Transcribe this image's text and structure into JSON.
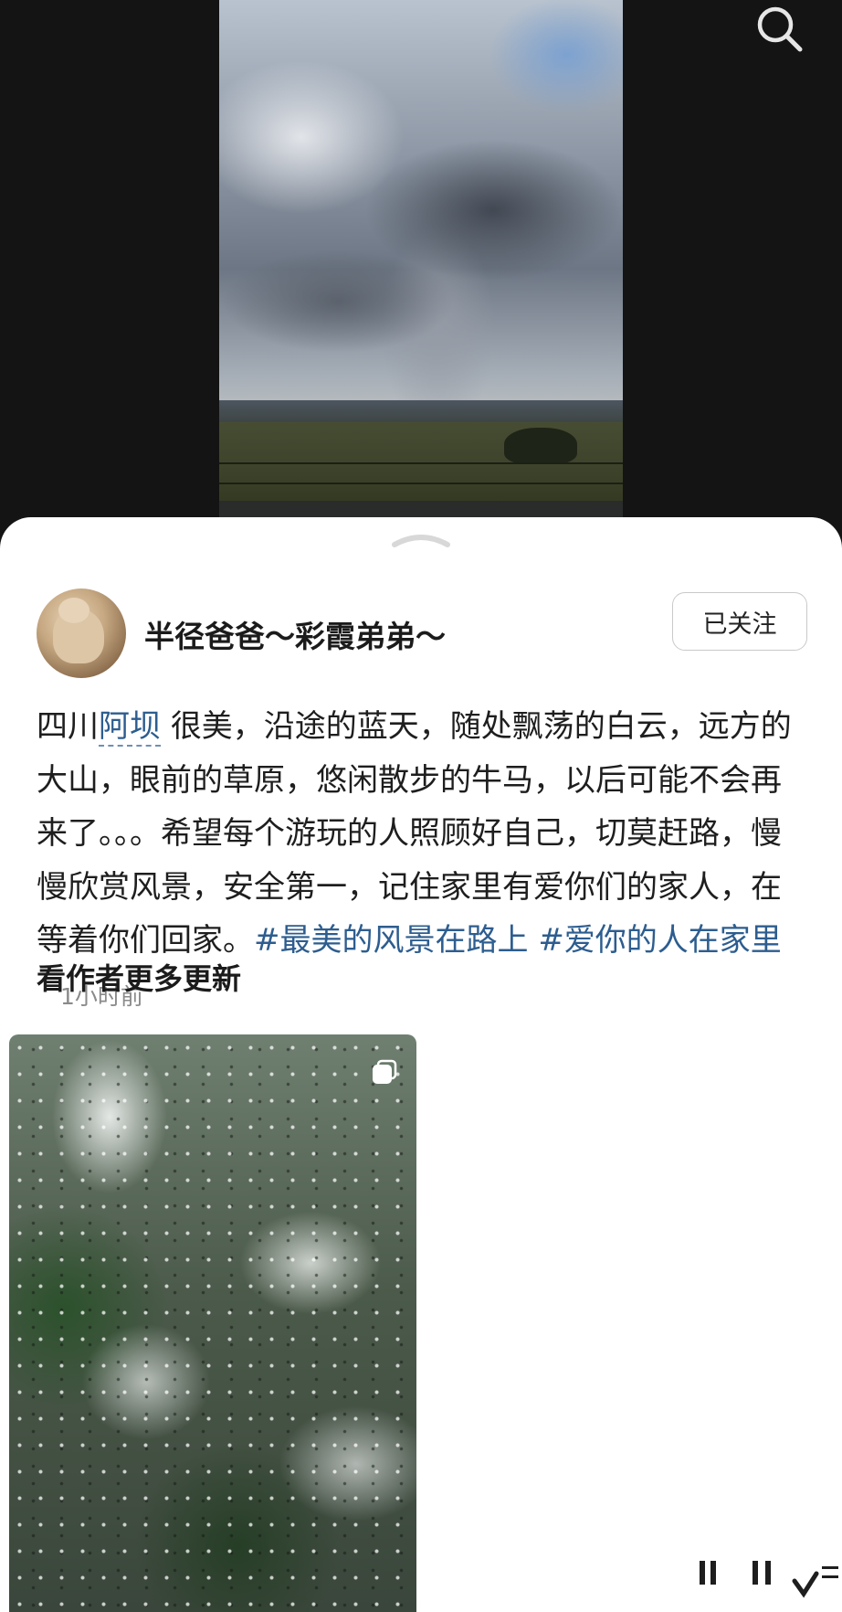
{
  "media": {
    "search_icon": "search-icon"
  },
  "sheet": {
    "collapse_icon": "chevron-up-icon"
  },
  "author": {
    "name": "半径爸爸～彩霞弟弟～",
    "follow_label": "已关注"
  },
  "post": {
    "text_before_location": "四川",
    "location": "阿坝",
    "text_after_location": "很美，沿途的蓝天，随处飘荡的白云，远方的大山，眼前的草原，悠闲散步的牛马，以后可能不会再来了。。。希望每个游玩的人照顾好自己，切莫赶路，慢慢欣赏风景，安全第一，记住家里有爱你们的家人，在等着你们回家。",
    "hashtags": [
      "#最美的风景在路上",
      "#爱你的人在家里"
    ],
    "time": "1小时前"
  },
  "more_updates": {
    "title": "看作者更多更新",
    "thumbnail_icon": "multi-image-icon"
  },
  "colors": {
    "link": "#2d5d8f",
    "media_background": "#141414"
  }
}
